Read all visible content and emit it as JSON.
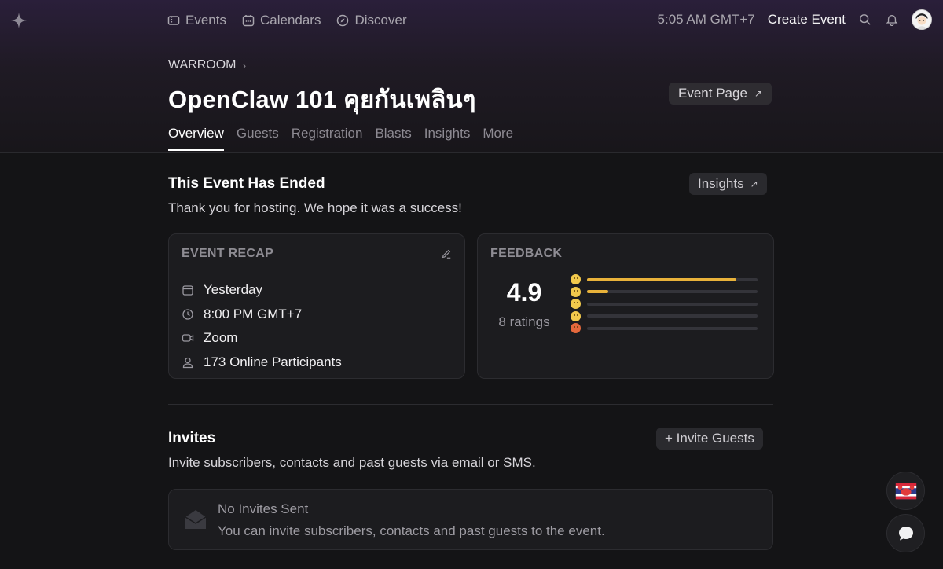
{
  "nav": {
    "events": "Events",
    "calendars": "Calendars",
    "discover": "Discover",
    "time": "5:05 AM GMT+7",
    "create_event": "Create Event"
  },
  "header": {
    "breadcrumb": "WARROOM",
    "title": "OpenClaw 101 คุยกันเพลินๆ",
    "event_page_button": "Event Page",
    "tabs": [
      "Overview",
      "Guests",
      "Registration",
      "Blasts",
      "Insights",
      "More"
    ],
    "active_tab": "Overview"
  },
  "ended": {
    "title": "This Event Has Ended",
    "subtitle": "Thank you for hosting. We hope it was a success!",
    "insights_button": "Insights"
  },
  "recap": {
    "label": "EVENT RECAP",
    "date": "Yesterday",
    "time": "8:00 PM GMT+7",
    "location": "Zoom",
    "participants": "173 Online Participants"
  },
  "feedback": {
    "label": "FEEDBACK",
    "rating": "4.9",
    "count": "8 ratings",
    "distribution": [
      {
        "rating": 5,
        "fraction": 0.875,
        "icon": "grinning-emoji-icon"
      },
      {
        "rating": 4,
        "fraction": 0.125,
        "icon": "smiling-emoji-icon"
      },
      {
        "rating": 3,
        "fraction": 0,
        "icon": "neutral-emoji-icon"
      },
      {
        "rating": 2,
        "fraction": 0,
        "icon": "sad-emoji-icon"
      },
      {
        "rating": 1,
        "fraction": 0,
        "icon": "angry-emoji-icon"
      }
    ],
    "bar_color": "#e8b23a"
  },
  "invites": {
    "title": "Invites",
    "subtitle": "Invite subscribers, contacts and past guests via email or SMS.",
    "invite_button": "+ Invite Guests",
    "empty_title": "No Invites Sent",
    "empty_subtitle": "You can invite subscribers, contacts and past guests to the event."
  }
}
